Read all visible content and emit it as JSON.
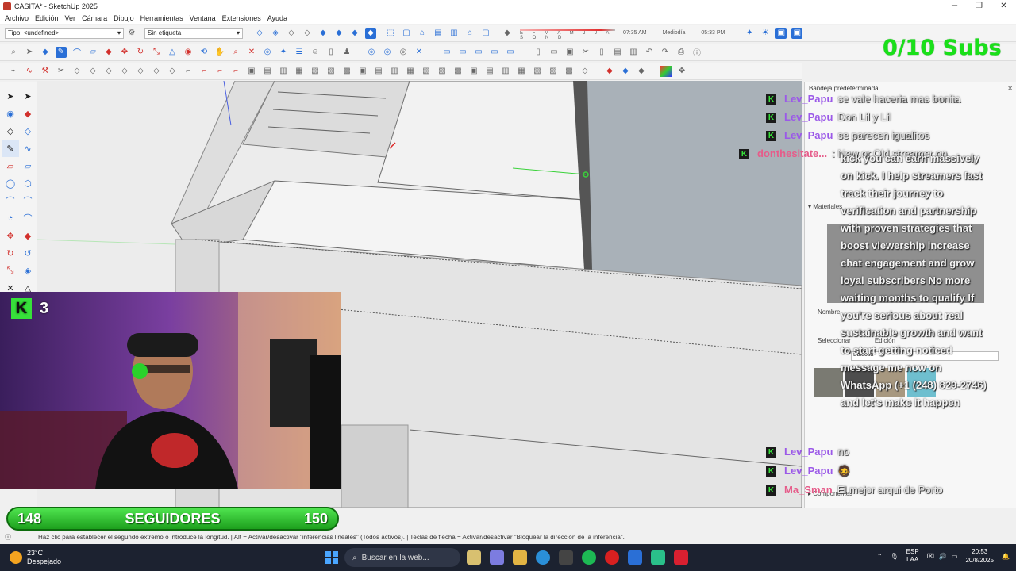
{
  "window": {
    "title": "CASITA* - SketchUp 2025"
  },
  "menu": [
    "Archivo",
    "Edición",
    "Ver",
    "Cámara",
    "Dibujo",
    "Herramientas",
    "Ventana",
    "Extensiones",
    "Ayuda"
  ],
  "toolbar": {
    "type_select": "Tipo: <undefined>",
    "tag_select": "Sin etiqueta",
    "months": "E F M A M J J A S O N D",
    "time_start": "07:35 AM",
    "time_mid": "Mediodía",
    "time_end": "05:33 PM"
  },
  "overlay": {
    "subs": "0/10 Subs",
    "webcam_count": "3",
    "followers_left": "148",
    "followers_label": "SEGUIDORES",
    "followers_right": "150"
  },
  "panel": {
    "title": "Bandeja predeterminada",
    "materials_header": "Materiales",
    "name_label": "Nombre",
    "tab_select": "Seleccionar",
    "tab_edit": "Edición",
    "library": "Baldosa",
    "components_header": "Componentes"
  },
  "chat": {
    "messages": [
      {
        "user": "Lev_Papu",
        "text": "se vale haceria mas bonita"
      },
      {
        "user": "Lev_Papu",
        "text": "Don Lil y Lil"
      },
      {
        "user": "Lev_Papu",
        "text": "se parecen igualitos"
      },
      {
        "user": "donthesitate...",
        "text": ": New or Old streamer on"
      },
      {
        "user": "Lev_Papu",
        "text": "no"
      },
      {
        "user": "Lev_Papu",
        "text": "🧔"
      },
      {
        "user": "Ma_Sman",
        "text": "El mejor arqui de Porto"
      }
    ],
    "long_text": "kick you can earn massively on kick. I help streamers fast track their journey to verification and partnership with proven strategies that boost viewership increase chat engagement and grow loyal subscribers No more waiting months to qualify If you're serious about real sustainable growth and want to start getting noticed message me now on WhatsApp (+1 (248) 829-2746) and let's make it happen"
  },
  "status": {
    "text": "Haz clic para establecer el segundo extremo o introduce la longitud. | Alt = Activar/desactivar \"inferencias lineales\" (Todos activos). | Teclas de flecha = Activar/desactivar \"Bloquear la dirección de la inferencia\"."
  },
  "taskbar": {
    "temp": "23°C",
    "weather": "Despejado",
    "search_placeholder": "Buscar en la web...",
    "lang1": "ESP",
    "lang2": "LAA",
    "time": "20:53",
    "date": "20/8/2025"
  }
}
